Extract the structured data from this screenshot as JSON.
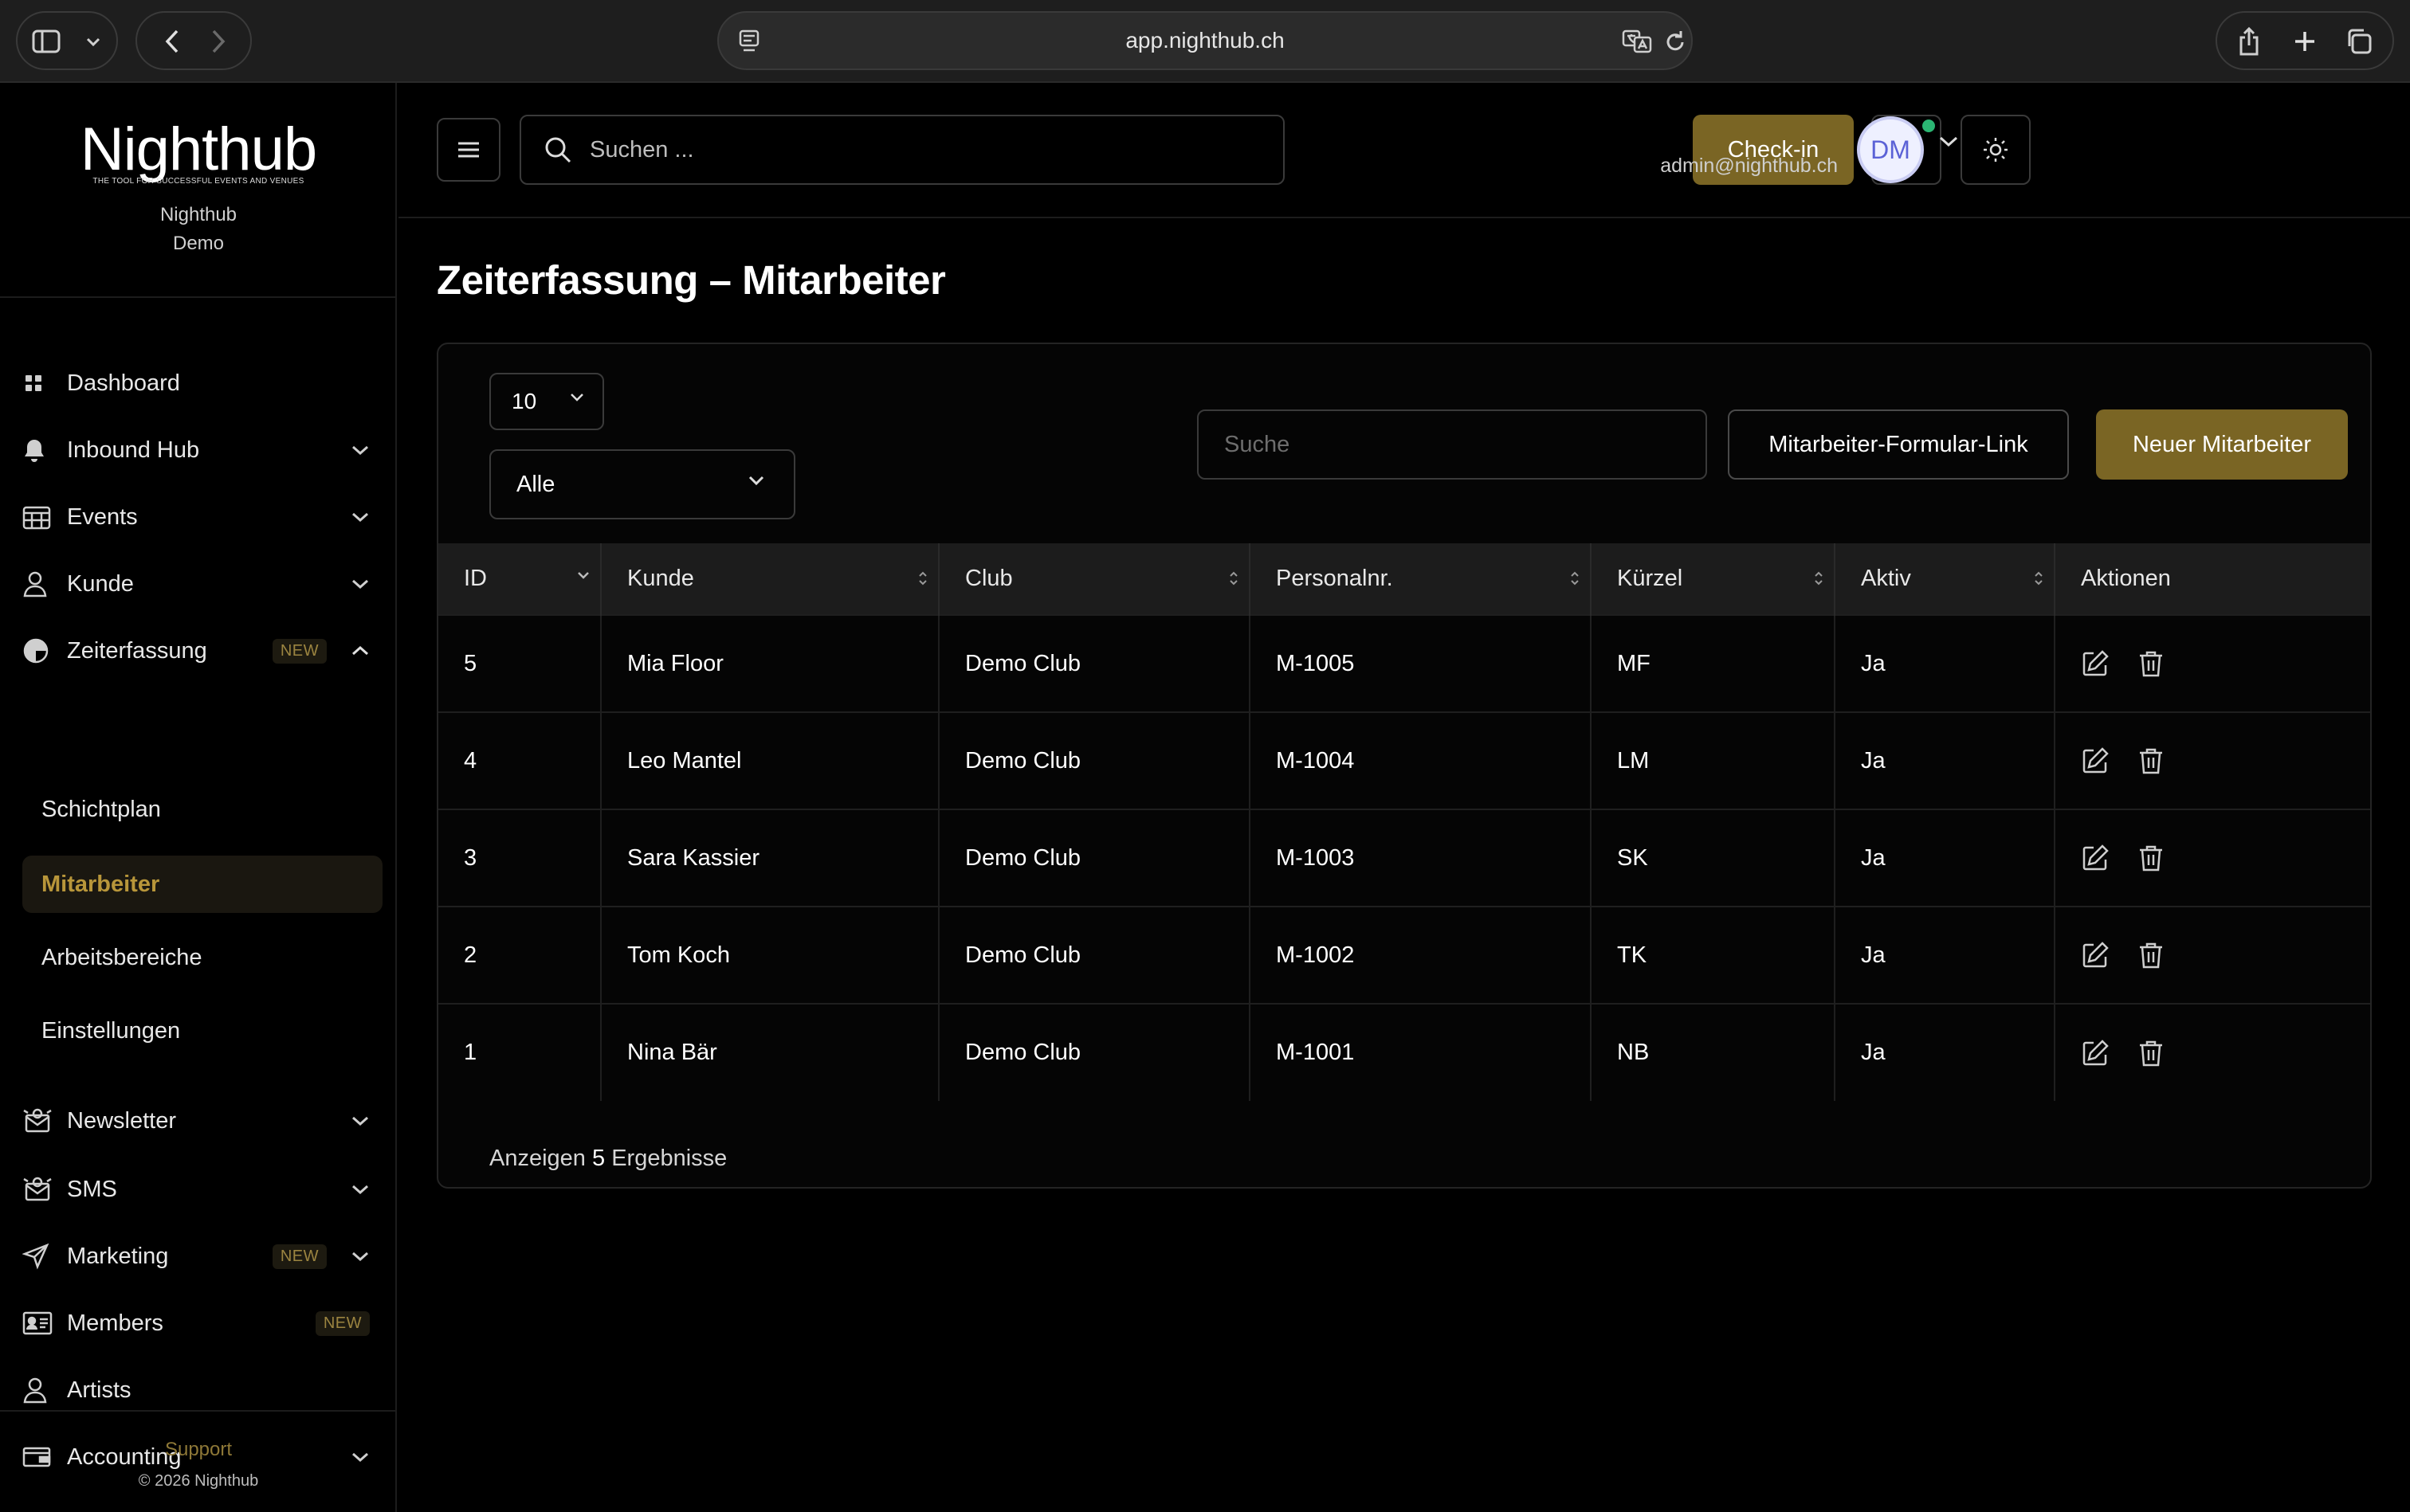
{
  "browser": {
    "url": "app.nighthub.ch"
  },
  "sidebar": {
    "logo": "Nighthub",
    "tagline": "THE TOOL FOR SUCCESSFUL EVENTS AND VENUES",
    "org_line1": "Nighthub",
    "org_line2": "Demo",
    "items": [
      {
        "label": "Dashboard",
        "icon": "grid-icon"
      },
      {
        "label": "Inbound Hub",
        "icon": "bell-icon"
      },
      {
        "label": "Events",
        "icon": "calendar-icon"
      },
      {
        "label": "Kunde",
        "icon": "user-icon"
      },
      {
        "label": "Zeiterfassung",
        "icon": "clock-icon",
        "badge": "NEW"
      },
      {
        "label": "Newsletter",
        "icon": "newsletter-icon"
      },
      {
        "label": "SMS",
        "icon": "sms-icon"
      },
      {
        "label": "Marketing",
        "icon": "send-icon",
        "badge": "NEW"
      },
      {
        "label": "Members",
        "icon": "members-icon",
        "badge": "NEW"
      },
      {
        "label": "Artists",
        "icon": "user-icon"
      },
      {
        "label": "Accounting",
        "icon": "wallet-icon"
      }
    ],
    "subitems": [
      {
        "label": "Schichtplan"
      },
      {
        "label": "Mitarbeiter",
        "active": true
      },
      {
        "label": "Arbeitsbereiche"
      },
      {
        "label": "Einstellungen"
      }
    ],
    "support": "Support",
    "copyright": "© 2026 Nighthub"
  },
  "topbar": {
    "search_placeholder": "Suchen ...",
    "checkin": "Check-in",
    "user_email": "admin@nighthub.ch",
    "avatar_initials": "DM"
  },
  "page": {
    "title": "Zeiterfassung – Mitarbeiter",
    "per_page": "10",
    "filter": "Alle",
    "search_placeholder": "Suche",
    "form_link_button": "Mitarbeiter-Formular-Link",
    "new_button": "Neuer Mitarbeiter"
  },
  "table": {
    "headers": [
      "ID",
      "Kunde",
      "Club",
      "Personalnr.",
      "Kürzel",
      "Aktiv",
      "Aktionen"
    ],
    "rows": [
      [
        "5",
        "Mia Floor",
        "Demo Club",
        "M-1005",
        "MF",
        "Ja"
      ],
      [
        "4",
        "Leo Mantel",
        "Demo Club",
        "M-1004",
        "LM",
        "Ja"
      ],
      [
        "3",
        "Sara Kassier",
        "Demo Club",
        "M-1003",
        "SK",
        "Ja"
      ],
      [
        "2",
        "Tom Koch",
        "Demo Club",
        "M-1002",
        "TK",
        "Ja"
      ],
      [
        "1",
        "Nina Bär",
        "Demo Club",
        "M-1001",
        "NB",
        "Ja"
      ]
    ],
    "footer_prefix": "Anzeigen",
    "footer_count": "5",
    "footer_suffix": "Ergebnisse"
  },
  "colors": {
    "accent": "#7a6524",
    "accent_text": "#b8963a",
    "status_dot": "#2bb673"
  }
}
